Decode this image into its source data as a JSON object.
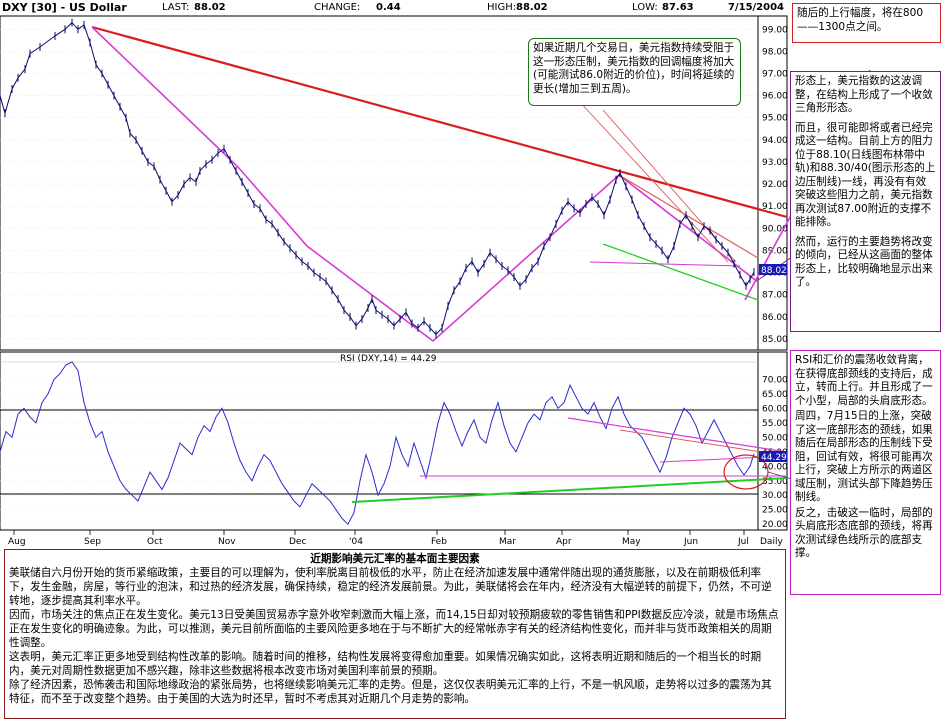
{
  "header": {
    "symbol": "DXY [30] - US Dollar",
    "last_label": "LAST:",
    "last_value": "88.02",
    "change_label": "CHANGE:",
    "change_value": "0.44",
    "high_label": "HIGH:",
    "high_value": "88.02",
    "low_label": "LOW:",
    "low_value": "87.63",
    "date": "7/15/2004"
  },
  "annotations": {
    "green_box": "如果近期几个交易日，美元指数持续受阻于这一形态压制，美元指数的回调幅度将加大(可能测试86.0附近的价位)，时间将延续的更长(增加三到五周)。",
    "red_top": "随后的上行幅度，将在800——1300点之间。",
    "purple_main": [
      "形态上，美元指数的这波调整，在结构上形成了一个收敛三角形形态。",
      "而且，很可能即将或者已经完成这一结构。目前上方的阻力位于88.10(日线图布林带中轨)和88.30/40(图示形态的上边压制线)一线，再没有有效突破这些阻力之前，美元指数再次测试87.00附近的支撑不能排除。",
      "然而，运行的主要趋势将改变的倾向，已经从这画面的整体形态上，比较明确地显示出来了。"
    ],
    "rsi_note": [
      "RSI和汇价的震荡收敛背离，在获得底部颈线的支持后，成立，转而上行。并且形成了一个小型，局部的头肩底形态。",
      "周四，7月15日的上涨，突破了这一底部形态的颈线，如果随后在局部形态的压制线下受阻，回试有效，将很可能再次上行，突破上方所示的两道区域压制，测试头部下降趋势压制线。",
      "反之，击破这一临时，局部的头肩底形态底部的颈线，将再次测试绿色线所示的底部支撑。"
    ]
  },
  "fundamentals": {
    "title": "近期影响美元汇率的基本面主要因素",
    "paragraphs": [
      "美联储自六月份开始的货币紧缩政策，主要目的可以理解为，使利率脱离目前极低的水平，防止在经济加速发展中通常伴随出现的通货膨胀，以及在前期极低利率下，发生金融，房屋，等行业的泡沫，和过热的经济发展，确保持续，稳定的经济发展前景。为此，美联储将会在年内，经济没有大幅逆转的前提下，仍然，不可逆转地，逐步提高其利率水平。",
      "因而，市场关注的焦点正在发生变化。美元13日受美国贸易赤字意外收窄刺激而大幅上涨，而14,15日却对较预期疲软的零售销售和PPI数据反应冷淡，就是市场焦点正在发生变化的明确迹象。为此，可以推测，美元目前所面临的主要风险更多地在于与不断扩大的经常帐赤字有关的经济结构性变化，而并非与货币政策相关的周期性调整。",
      "这表明，美元汇率正更多地受到结构性改革的影响。随着时间的推移，结构性发展将变得愈加重要。如果情况确实如此，这将表明近期和随后的一个相当长的时期内，美元对周期性数据更加不感兴趣，除非这些数据将根本改变市场对美国利率前景的预期。",
      "除了经济因素，恐怖袭击和国际地缘政治的紧张局势，也将继续影响美元汇率的走势。但是，这仅仅表明美元汇率的上行，不是一帆风顺，走势将以过多的震荡为其特征，而不至于改变整个趋势。由于美国的大选为时还早，暂时不考虑其对近期几个月走势的影响。"
    ]
  },
  "colors": {
    "price": "#0a0a6e",
    "rsi": "#2a2ad0",
    "trend_red": "#d81e1e",
    "magenta": "#d63bd6",
    "green_line": "#22cc22",
    "thin_red": "#e05a5a",
    "box_red": "#d02020",
    "box_purple": "#7a1a8a",
    "box_green": "#1a7a1a",
    "box_brown": "#8b1a1a",
    "last_tag": "#1a1ab0"
  },
  "chart_data": [
    {
      "type": "ohlc",
      "title": "DXY [30] - US Dollar",
      "x": [
        "Aug",
        "Sep",
        "Oct",
        "Nov",
        "Dec",
        "'04",
        "Feb",
        "Mar",
        "Apr",
        "May",
        "Jun",
        "Jul",
        "Daily"
      ],
      "yticks": [
        "85.00",
        "86.00",
        "87.00",
        "88.00",
        "89.00",
        "90.00",
        "91.00",
        "92.00",
        "93.00",
        "94.00",
        "95.00",
        "96.00",
        "97.00",
        "98.00",
        "99.00"
      ],
      "ylim": [
        84.5,
        99.6
      ],
      "last_tag": "88.02",
      "path_points": [
        [
          0,
          96
        ],
        [
          5,
          95.2
        ],
        [
          12,
          96.3
        ],
        [
          18,
          96.8
        ],
        [
          25,
          97.2
        ],
        [
          30,
          97.9
        ],
        [
          40,
          98.2
        ],
        [
          55,
          98.7
        ],
        [
          65,
          99.0
        ],
        [
          72,
          99.3
        ],
        [
          78,
          99.0
        ],
        [
          84,
          99.2
        ],
        [
          90,
          98.4
        ],
        [
          96,
          97.4
        ],
        [
          102,
          97.0
        ],
        [
          108,
          96.5
        ],
        [
          114,
          96.0
        ],
        [
          120,
          95.5
        ],
        [
          126,
          95.0
        ],
        [
          130,
          94.3
        ],
        [
          136,
          94.0
        ],
        [
          142,
          93.5
        ],
        [
          148,
          93.0
        ],
        [
          154,
          92.8
        ],
        [
          160,
          92.2
        ],
        [
          166,
          91.7
        ],
        [
          172,
          91.2
        ],
        [
          178,
          91.5
        ],
        [
          184,
          92.0
        ],
        [
          190,
          92.3
        ],
        [
          196,
          92.1
        ],
        [
          200,
          92.6
        ],
        [
          206,
          92.9
        ],
        [
          212,
          93.1
        ],
        [
          218,
          93.4
        ],
        [
          224,
          93.6
        ],
        [
          230,
          93.1
        ],
        [
          236,
          92.6
        ],
        [
          242,
          92.1
        ],
        [
          248,
          91.6
        ],
        [
          254,
          91.1
        ],
        [
          260,
          90.9
        ],
        [
          266,
          90.4
        ],
        [
          272,
          90.2
        ],
        [
          278,
          89.8
        ],
        [
          284,
          89.4
        ],
        [
          290,
          89.1
        ],
        [
          296,
          88.8
        ],
        [
          302,
          88.5
        ],
        [
          308,
          88.3
        ],
        [
          314,
          88.0
        ],
        [
          320,
          87.8
        ],
        [
          326,
          87.6
        ],
        [
          332,
          87.2
        ],
        [
          338,
          86.8
        ],
        [
          344,
          86.3
        ],
        [
          350,
          86.0
        ],
        [
          356,
          85.6
        ],
        [
          362,
          85.9
        ],
        [
          368,
          86.4
        ],
        [
          372,
          86.8
        ],
        [
          376,
          86.3
        ],
        [
          382,
          86.1
        ],
        [
          388,
          85.9
        ],
        [
          394,
          85.6
        ],
        [
          400,
          85.9
        ],
        [
          406,
          86.2
        ],
        [
          412,
          85.7
        ],
        [
          418,
          85.5
        ],
        [
          424,
          85.8
        ],
        [
          430,
          85.5
        ],
        [
          436,
          85.2
        ],
        [
          442,
          85.5
        ],
        [
          448,
          86.5
        ],
        [
          454,
          87.2
        ],
        [
          460,
          87.6
        ],
        [
          466,
          88.2
        ],
        [
          472,
          88.5
        ],
        [
          478,
          88.0
        ],
        [
          484,
          88.4
        ],
        [
          490,
          88.9
        ],
        [
          496,
          88.6
        ],
        [
          502,
          88.3
        ],
        [
          508,
          88.1
        ],
        [
          514,
          87.8
        ],
        [
          520,
          87.4
        ],
        [
          526,
          87.7
        ],
        [
          532,
          88.2
        ],
        [
          538,
          88.5
        ],
        [
          544,
          89.2
        ],
        [
          550,
          89.6
        ],
        [
          556,
          90.2
        ],
        [
          562,
          90.8
        ],
        [
          568,
          91.2
        ],
        [
          574,
          90.9
        ],
        [
          580,
          90.7
        ],
        [
          586,
          91.1
        ],
        [
          592,
          91.4
        ],
        [
          598,
          91.1
        ],
        [
          604,
          90.6
        ],
        [
          610,
          91.3
        ],
        [
          616,
          92.2
        ],
        [
          620,
          92.5
        ],
        [
          626,
          91.9
        ],
        [
          632,
          91.3
        ],
        [
          638,
          90.6
        ],
        [
          644,
          90.1
        ],
        [
          650,
          89.6
        ],
        [
          656,
          89.3
        ],
        [
          662,
          89.0
        ],
        [
          668,
          88.6
        ],
        [
          674,
          89.2
        ],
        [
          680,
          90.2
        ],
        [
          686,
          90.6
        ],
        [
          692,
          90.1
        ],
        [
          698,
          89.6
        ],
        [
          704,
          90.1
        ],
        [
          710,
          89.9
        ],
        [
          716,
          89.5
        ],
        [
          722,
          89.2
        ],
        [
          728,
          88.9
        ],
        [
          734,
          88.4
        ],
        [
          740,
          87.9
        ],
        [
          746,
          87.4
        ],
        [
          750,
          87.7
        ],
        [
          754,
          88.02
        ]
      ],
      "annotations": [
        "88.02"
      ]
    },
    {
      "type": "line",
      "title": "RSI (DXY,14) = 44.29",
      "yticks": [
        "20.00",
        "25.00",
        "30.00",
        "35.00",
        "40.00",
        "45.00",
        "50.00",
        "55.00",
        "60.00",
        "65.00",
        "70.00"
      ],
      "ylim": [
        18,
        76
      ],
      "last_tag": "44.29",
      "path_points": [
        [
          0,
          45
        ],
        [
          6,
          52
        ],
        [
          12,
          50
        ],
        [
          18,
          58
        ],
        [
          24,
          60
        ],
        [
          30,
          57
        ],
        [
          36,
          55
        ],
        [
          42,
          62
        ],
        [
          48,
          65
        ],
        [
          54,
          70
        ],
        [
          60,
          72
        ],
        [
          66,
          75
        ],
        [
          72,
          76
        ],
        [
          78,
          73
        ],
        [
          84,
          62
        ],
        [
          90,
          55
        ],
        [
          96,
          50
        ],
        [
          102,
          52
        ],
        [
          108,
          45
        ],
        [
          114,
          40
        ],
        [
          120,
          35
        ],
        [
          126,
          32
        ],
        [
          132,
          30
        ],
        [
          138,
          28
        ],
        [
          144,
          33
        ],
        [
          150,
          38
        ],
        [
          156,
          35
        ],
        [
          162,
          32
        ],
        [
          168,
          36
        ],
        [
          174,
          42
        ],
        [
          180,
          48
        ],
        [
          186,
          46
        ],
        [
          192,
          44
        ],
        [
          198,
          50
        ],
        [
          204,
          54
        ],
        [
          210,
          52
        ],
        [
          216,
          57
        ],
        [
          222,
          60
        ],
        [
          228,
          55
        ],
        [
          234,
          48
        ],
        [
          240,
          42
        ],
        [
          246,
          38
        ],
        [
          252,
          35
        ],
        [
          258,
          40
        ],
        [
          264,
          44
        ],
        [
          270,
          42
        ],
        [
          276,
          38
        ],
        [
          282,
          34
        ],
        [
          288,
          31
        ],
        [
          294,
          28
        ],
        [
          300,
          26
        ],
        [
          306,
          30
        ],
        [
          312,
          34
        ],
        [
          318,
          32
        ],
        [
          324,
          30
        ],
        [
          330,
          28
        ],
        [
          336,
          25
        ],
        [
          342,
          22
        ],
        [
          348,
          20
        ],
        [
          354,
          24
        ],
        [
          360,
          35
        ],
        [
          366,
          44
        ],
        [
          372,
          38
        ],
        [
          378,
          30
        ],
        [
          384,
          34
        ],
        [
          390,
          40
        ],
        [
          396,
          50
        ],
        [
          402,
          44
        ],
        [
          408,
          40
        ],
        [
          414,
          48
        ],
        [
          420,
          42
        ],
        [
          426,
          36
        ],
        [
          432,
          45
        ],
        [
          438,
          55
        ],
        [
          444,
          62
        ],
        [
          450,
          58
        ],
        [
          456,
          52
        ],
        [
          462,
          47
        ],
        [
          468,
          52
        ],
        [
          474,
          56
        ],
        [
          480,
          50
        ],
        [
          486,
          48
        ],
        [
          492,
          56
        ],
        [
          498,
          62
        ],
        [
          504,
          54
        ],
        [
          510,
          48
        ],
        [
          516,
          45
        ],
        [
          522,
          50
        ],
        [
          528,
          55
        ],
        [
          534,
          58
        ],
        [
          540,
          56
        ],
        [
          546,
          62
        ],
        [
          552,
          64
        ],
        [
          558,
          60
        ],
        [
          564,
          62
        ],
        [
          570,
          68
        ],
        [
          576,
          64
        ],
        [
          582,
          60
        ],
        [
          588,
          58
        ],
        [
          594,
          62
        ],
        [
          600,
          57
        ],
        [
          606,
          53
        ],
        [
          612,
          60
        ],
        [
          618,
          64
        ],
        [
          624,
          58
        ],
        [
          630,
          54
        ],
        [
          636,
          52
        ],
        [
          642,
          50
        ],
        [
          648,
          46
        ],
        [
          654,
          42
        ],
        [
          660,
          38
        ],
        [
          666,
          43
        ],
        [
          672,
          50
        ],
        [
          678,
          55
        ],
        [
          684,
          60
        ],
        [
          690,
          58
        ],
        [
          696,
          54
        ],
        [
          702,
          48
        ],
        [
          708,
          52
        ],
        [
          714,
          56
        ],
        [
          720,
          52
        ],
        [
          726,
          48
        ],
        [
          732,
          44
        ],
        [
          738,
          40
        ],
        [
          744,
          37
        ],
        [
          750,
          40
        ],
        [
          754,
          44.29
        ]
      ],
      "annotations": [
        "44.29"
      ]
    }
  ]
}
